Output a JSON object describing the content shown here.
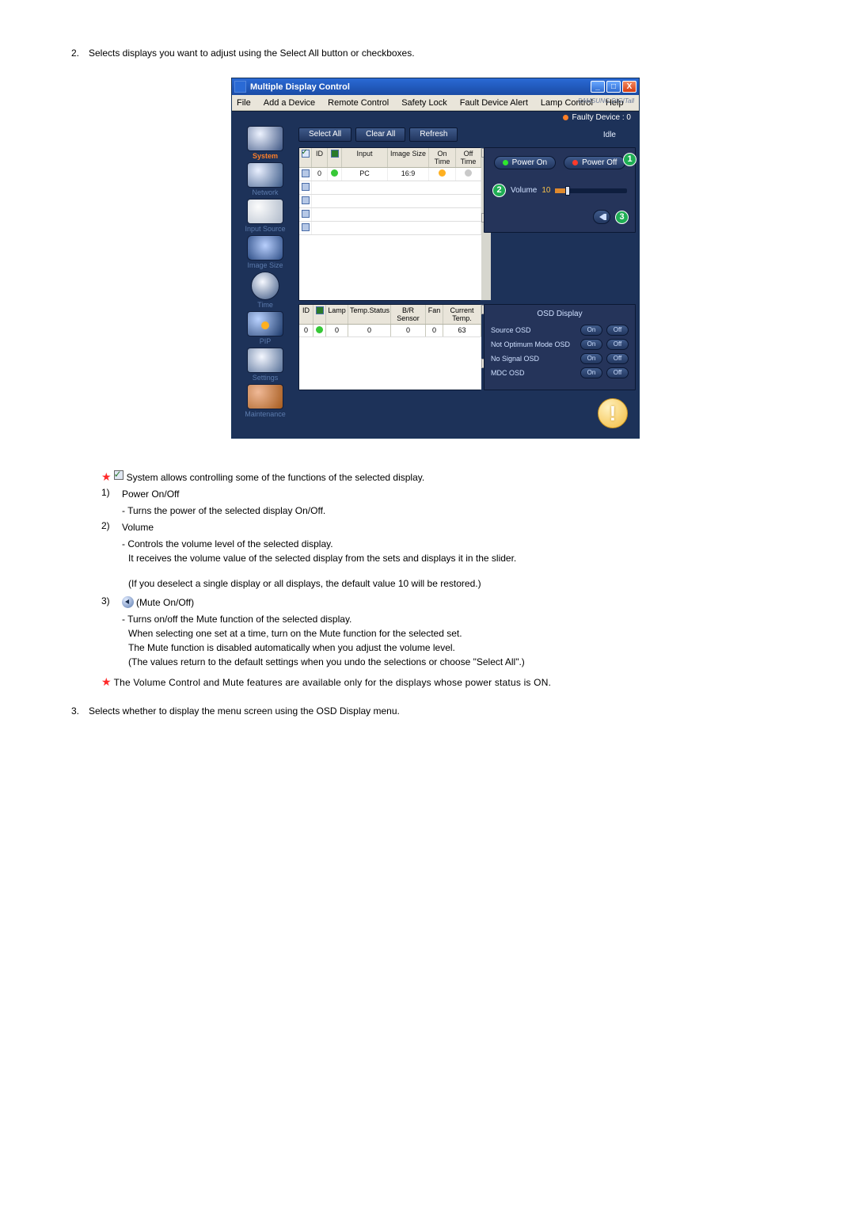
{
  "step2": {
    "num": "2.",
    "text": "Selects displays you want to adjust using the Select All button or checkboxes."
  },
  "titlebar": {
    "title": "Multiple Display Control"
  },
  "winbtns": {
    "min": "_",
    "max": "□",
    "close": "X"
  },
  "menubar": {
    "items": [
      "File",
      "Add a Device",
      "Remote Control",
      "Safety Lock",
      "Fault Device Alert",
      "Lamp Control",
      "Help"
    ],
    "brand": "SAMSUNG DIGITall"
  },
  "faulty": {
    "label": "Faulty Device : 0"
  },
  "topbtns": {
    "select_all": "Select All",
    "clear_all": "Clear All",
    "refresh": "Refresh",
    "idle": "Idle"
  },
  "sidebar": {
    "system": "System",
    "network": "Network",
    "input": "Input Source",
    "image": "Image Size",
    "time": "Time",
    "pip": "PIP",
    "settings": "Settings",
    "maint": "Maintenance"
  },
  "dthead": {
    "id": "ID",
    "input": "Input",
    "image": "Image Size",
    "on": "On Time",
    "off": "Off Time"
  },
  "dtrow": {
    "id": "0",
    "input": "PC",
    "image": "16:9"
  },
  "power": {
    "on": "Power On",
    "off": "Power Off",
    "volume_label": "Volume",
    "volume_value": "10"
  },
  "callouts": {
    "c1": "1",
    "c2": "2",
    "c3": "3"
  },
  "sthead": {
    "id": "ID",
    "lamp": "Lamp",
    "temp": "Temp.Status",
    "br": "B/R Sensor",
    "fan": "Fan",
    "cur": "Current Temp."
  },
  "strow": {
    "id": "0",
    "lamp": "0",
    "temp": "0",
    "br": "0",
    "fan": "0",
    "cur": "63"
  },
  "osd": {
    "title": "OSD Display",
    "source": "Source OSD",
    "notopt": "Not Optimum Mode OSD",
    "nosig": "No Signal OSD",
    "mdc": "MDC OSD",
    "on": "On",
    "off": "Off"
  },
  "scroll": {
    "up": "▲",
    "down": "▼"
  },
  "below": {
    "intro": "System allows controlling some of the functions of the selected display.",
    "i1n": "1)",
    "i1t": "Power On/Off",
    "i1s": "- Turns the power of the selected display On/Off.",
    "i2n": "2)",
    "i2t": "Volume",
    "i2s1": "- Controls the volume level of the selected display.",
    "i2s2": "It receives the volume value of the selected display from the sets and displays it in the slider.",
    "i2s3": "(If you deselect a single display or all displays, the default value 10 will be restored.)",
    "i3n": "3)",
    "i3t": "(Mute On/Off)",
    "i3s1": "- Turns on/off the Mute function of the selected display.",
    "i3s2": "When selecting one set at a time, turn on the Mute function for the selected set.",
    "i3s3": "The Mute function is disabled automatically when you adjust the volume level.",
    "i3s4": "(The values return to the default settings when you undo the selections or choose \"Select All\".)",
    "note": "The Volume Control and Mute features are available only for the displays whose power status is ON."
  },
  "step3": {
    "num": "3.",
    "text": "Selects whether to display the menu screen using the OSD Display menu."
  }
}
